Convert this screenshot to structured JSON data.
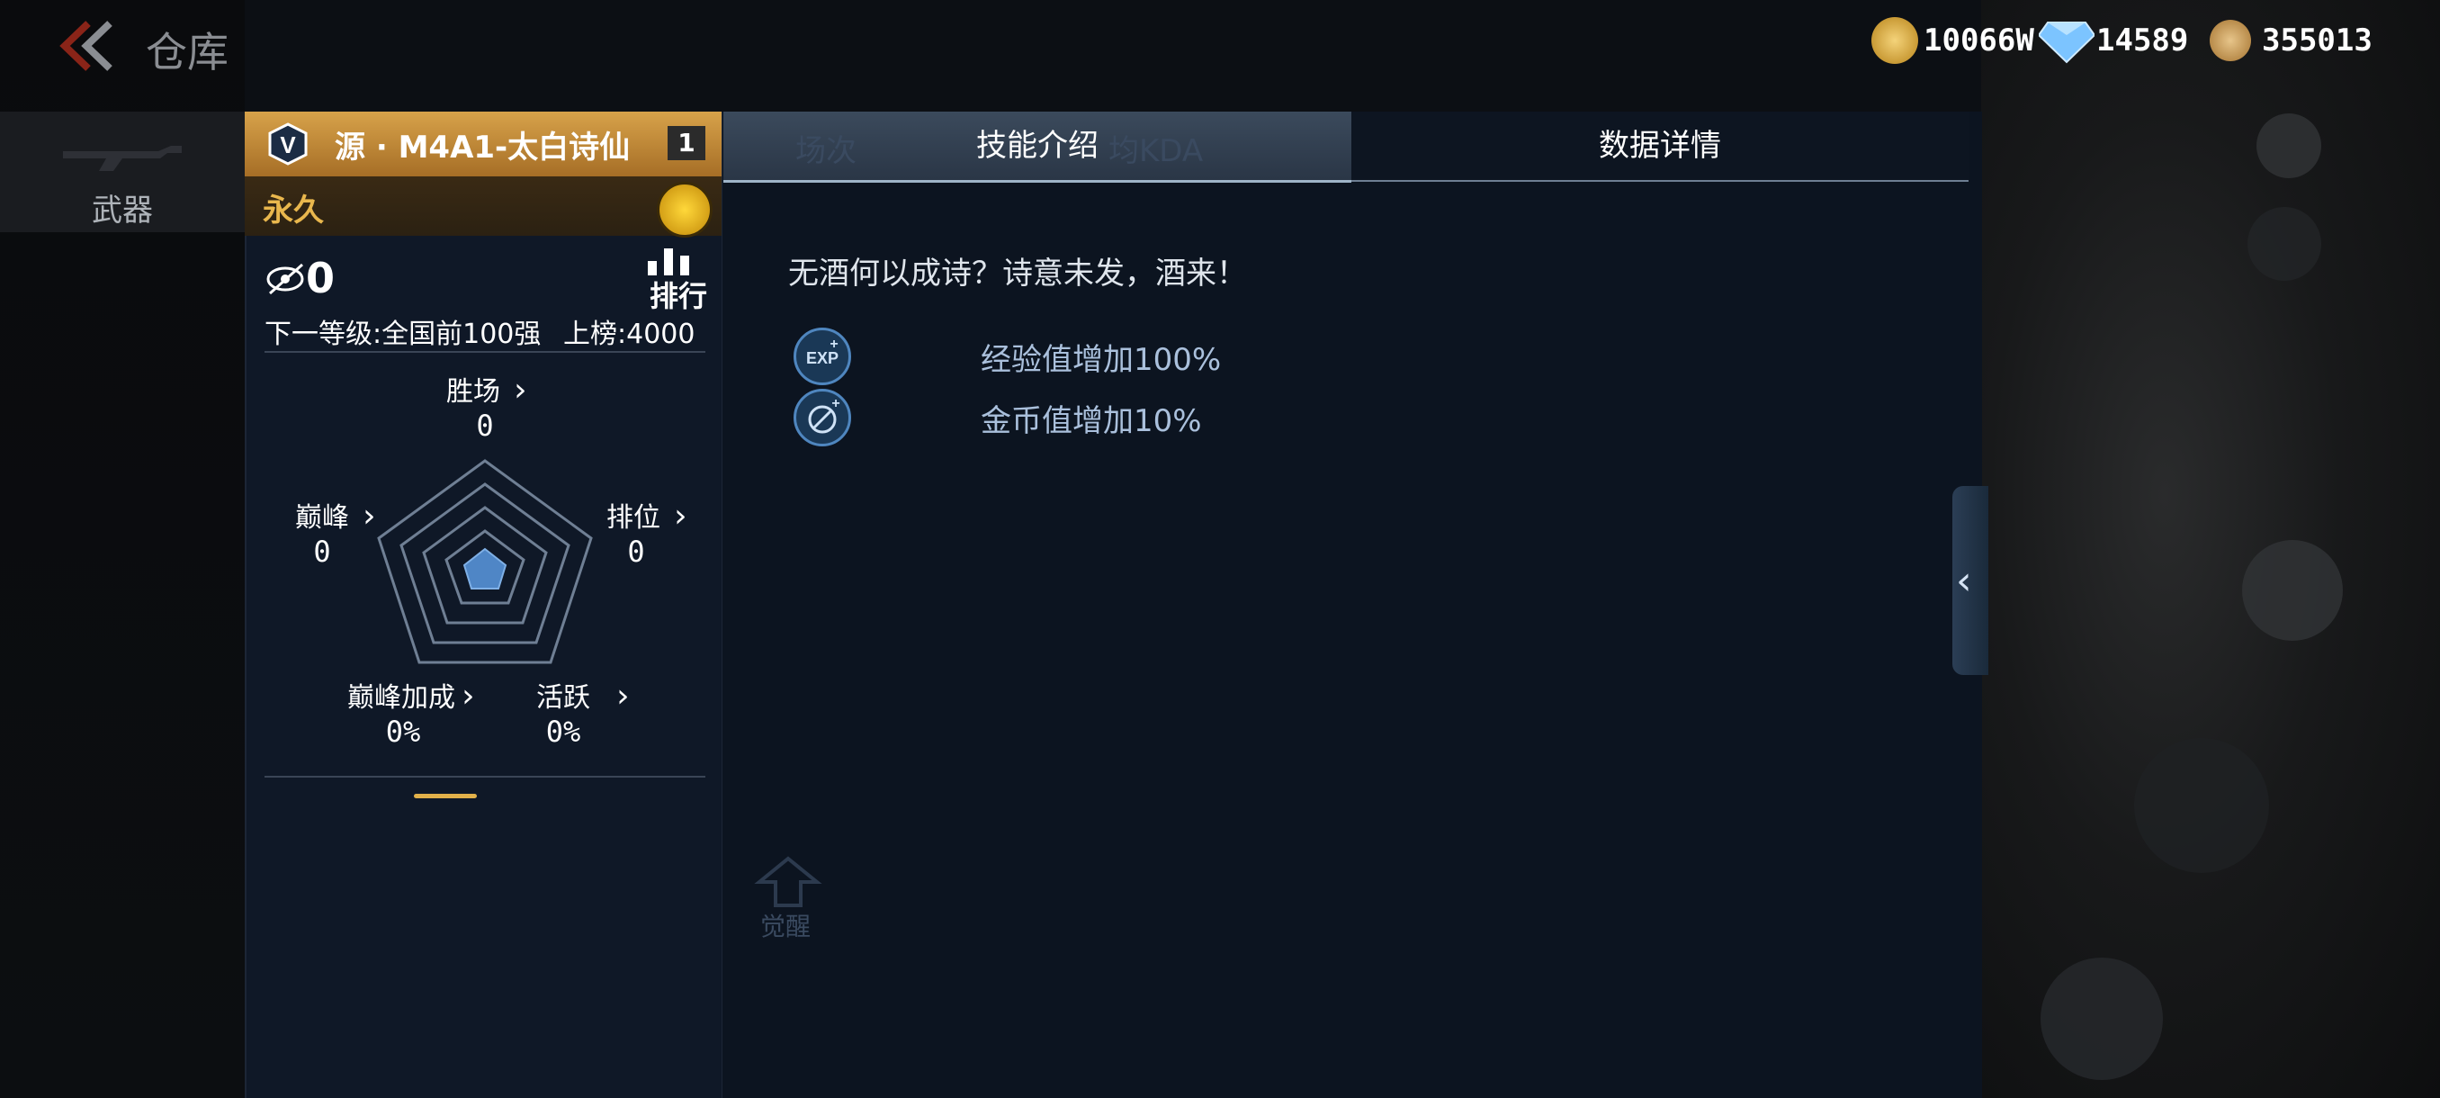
{
  "header": {
    "title": "仓库",
    "left_tab_label": "武器"
  },
  "currency": [
    {
      "icon": "gold-bullet-coin-icon",
      "value": "10066W"
    },
    {
      "icon": "diamond-icon",
      "value": "14589"
    },
    {
      "icon": "crossed-swords-token-icon",
      "value": "355013"
    }
  ],
  "weapon": {
    "name": "源 · M4A1-太白诗仙",
    "number": "1",
    "duration": "永久",
    "rank_count": "0",
    "next_level": "下一等级:全国前100强",
    "rank_target": "上榜:4000",
    "rank_button": "排行"
  },
  "radar": {
    "top": {
      "label": "胜场",
      "value": "0"
    },
    "left": {
      "label": "巅峰",
      "value": "0"
    },
    "right": {
      "label": "排位",
      "value": "0"
    },
    "bottom_left": {
      "label": "巅峰加成",
      "value": "0%"
    },
    "bottom_right": {
      "label": "活跃",
      "value": "0%"
    }
  },
  "tabs": {
    "skill": "技能介绍",
    "data": "数据详情"
  },
  "ghost_text": {
    "col1": "场次",
    "col2": "均KDA",
    "awaken": "觉醒"
  },
  "skill": {
    "description": "无酒何以成诗？诗意未发，酒来！",
    "items": [
      {
        "icon": "exp-plus-icon",
        "text": "经验值增加100%"
      },
      {
        "icon": "coin-plus-icon",
        "text": "金币值增加10%"
      }
    ]
  },
  "colors": {
    "accent_gold": "#e2b14a",
    "panel_bg": "#0c1420",
    "name_bar_gold": "#d7a24a"
  }
}
